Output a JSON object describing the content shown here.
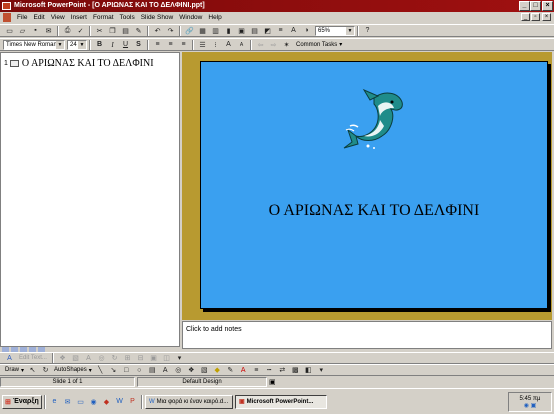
{
  "window": {
    "title": "Microsoft PowerPoint - [Ο ΑΡΙΩΝΑΣ ΚΑΙ ΤΟ ΔΕΛΦΙΝΙ.ppt]"
  },
  "menu": {
    "items": [
      "File",
      "Edit",
      "View",
      "Insert",
      "Format",
      "Tools",
      "Slide Show",
      "Window",
      "Help"
    ]
  },
  "standard_toolbar": {
    "zoom": "65%",
    "help": "?"
  },
  "formatting_toolbar": {
    "font": "Times New Roman",
    "size": "24",
    "bold": "B",
    "italic": "I",
    "underline": "U",
    "shadow": "S",
    "common_tasks": "Common Tasks"
  },
  "outline": {
    "slide_number": "1",
    "title": "Ο ΑΡΙΩΝΑΣ ΚΑΙ ΤΟ ΔΕΛΦΙΝΙ"
  },
  "slide": {
    "title": "Ο ΑΡΙΩΝΑΣ ΚΑΙ ΤΟ ΔΕΛΦΙΝΙ",
    "background": "#3aa0f0"
  },
  "notes": {
    "placeholder": "Click to add notes"
  },
  "edit_toolbar": {
    "label": "Edit Text..."
  },
  "drawing_toolbar": {
    "draw": "Draw",
    "autoshapes": "AutoShapes"
  },
  "status": {
    "slide": "Slide 1 of 1",
    "design": "Default Design"
  },
  "taskbar": {
    "start": "Έναρξη",
    "tasks": [
      "Μια φορά κι έναν καιρό.d...",
      "Microsoft PowerPoint..."
    ],
    "time": "5:45 πμ"
  }
}
